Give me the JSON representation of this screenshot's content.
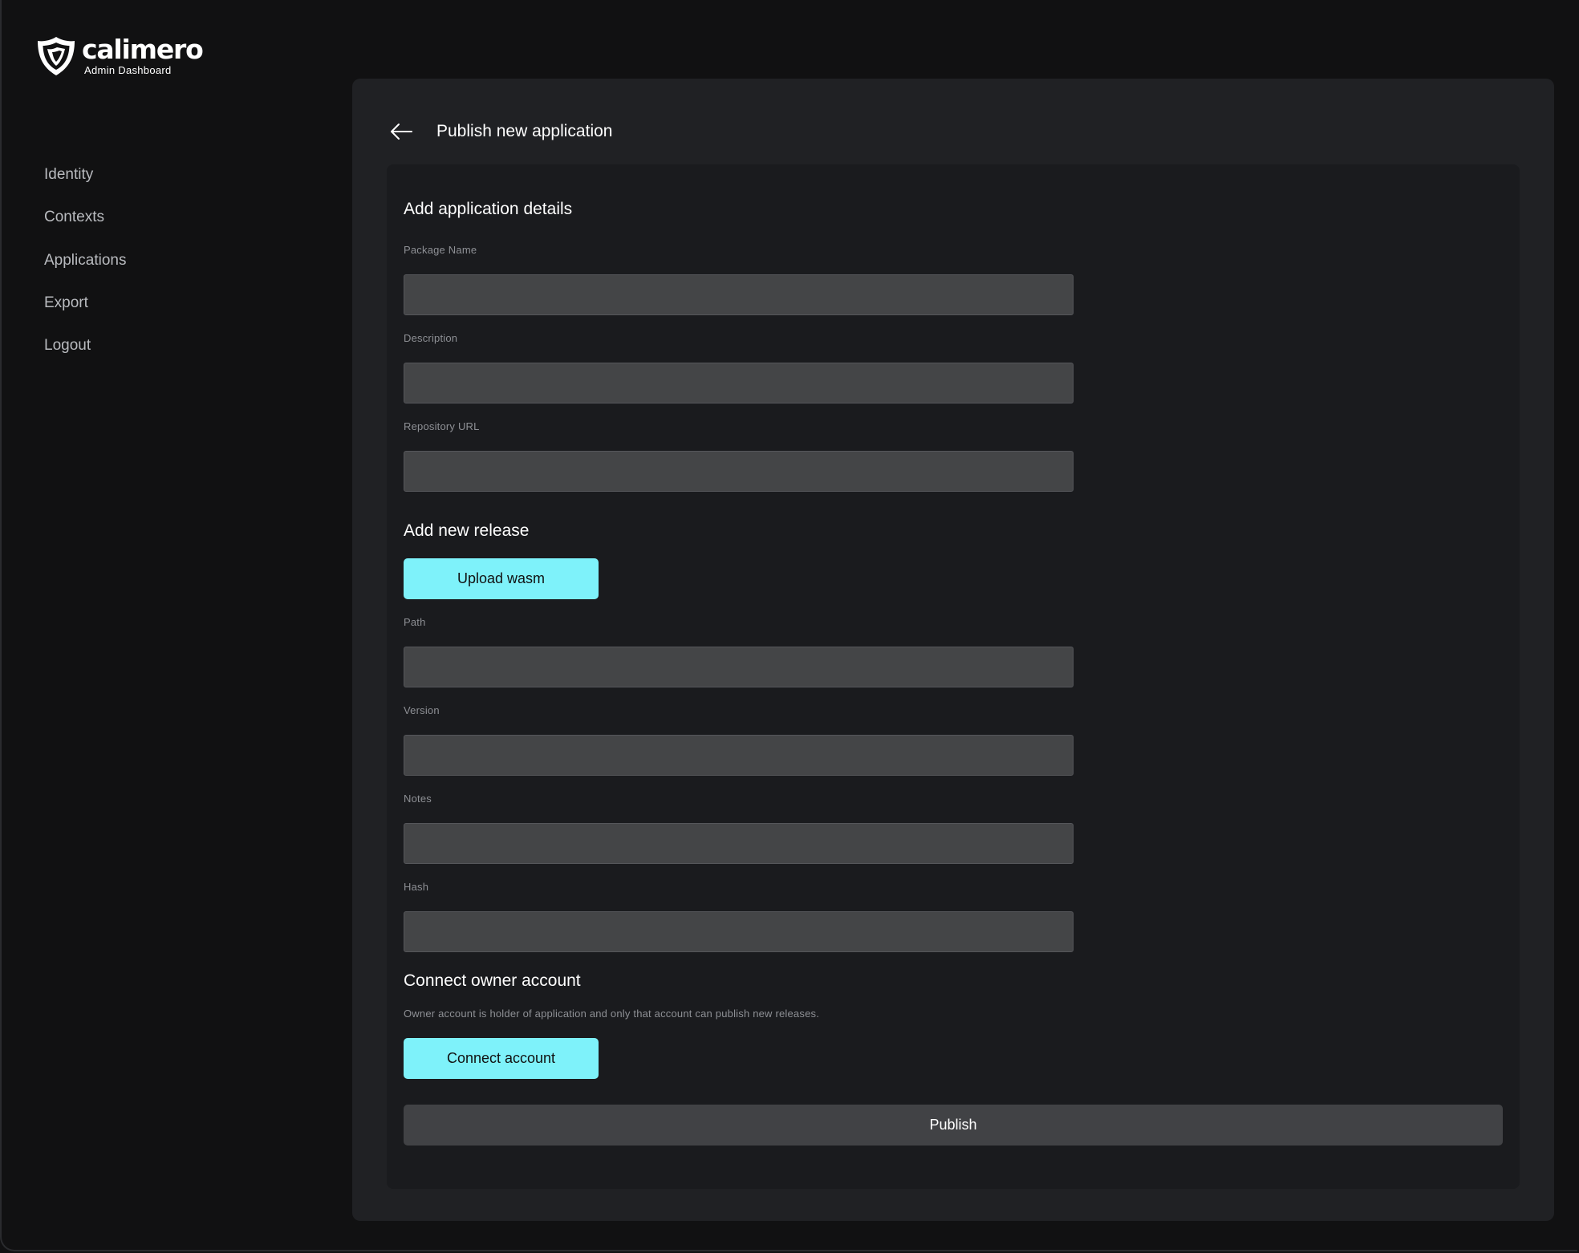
{
  "brand": {
    "name": "calimero",
    "subtitle": "Admin Dashboard"
  },
  "sidebar": {
    "items": [
      {
        "label": "Identity"
      },
      {
        "label": "Contexts"
      },
      {
        "label": "Applications"
      },
      {
        "label": "Export"
      },
      {
        "label": "Logout"
      }
    ]
  },
  "header": {
    "back_icon": "arrow-left-icon",
    "title": "Publish new application"
  },
  "details": {
    "title": "Add application details",
    "package_name": {
      "label": "Package Name",
      "value": ""
    },
    "description": {
      "label": "Description",
      "value": ""
    },
    "repository_url": {
      "label": "Repository URL",
      "value": ""
    }
  },
  "release": {
    "title": "Add new release",
    "upload_label": "Upload wasm",
    "path": {
      "label": "Path",
      "value": ""
    },
    "version": {
      "label": "Version",
      "value": ""
    },
    "notes": {
      "label": "Notes",
      "value": ""
    },
    "hash": {
      "label": "Hash",
      "value": ""
    }
  },
  "owner": {
    "title": "Connect owner account",
    "helper": "Owner account is holder of application and only that account can publish new releases.",
    "connect_label": "Connect account"
  },
  "publish_label": "Publish",
  "colors": {
    "background": "#111112",
    "panel": "#202124",
    "card": "#1a1b1e",
    "input": "#444547",
    "accent": "#7ef2fa",
    "publish_button": "#414245"
  }
}
